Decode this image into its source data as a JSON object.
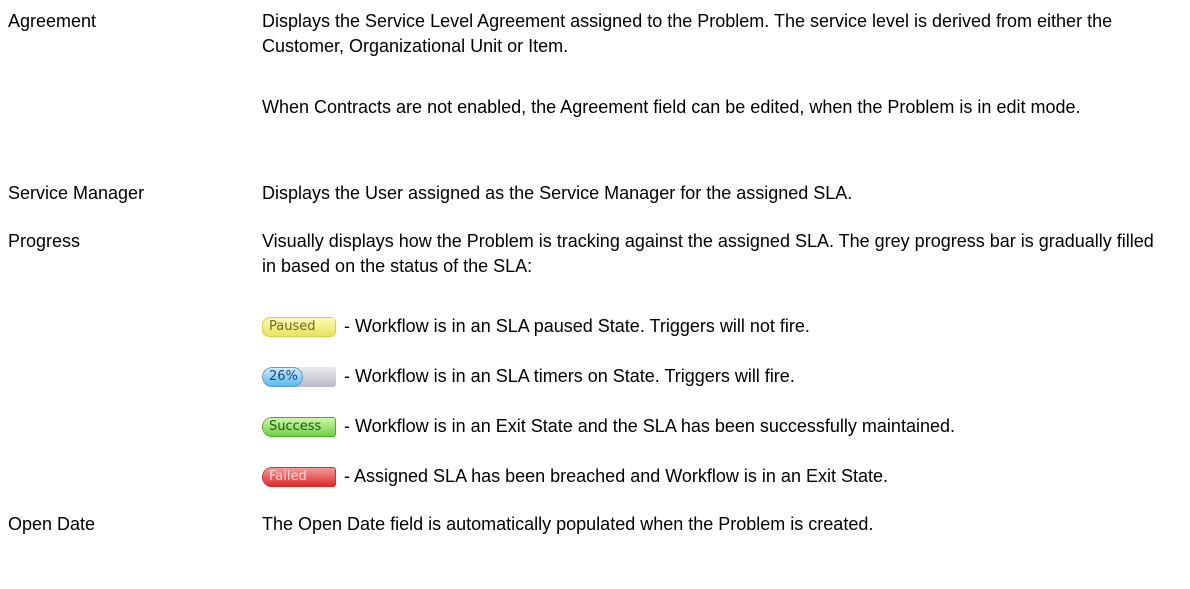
{
  "fields": [
    {
      "term": "Agreement",
      "paragraphs": [
        "Displays the Service Level Agreement assigned to the Problem. The service level is derived from either the Customer, Organizational Unit or Item.",
        "When Contracts are not enabled, the Agreement field can be edited, when the Problem is in edit mode."
      ]
    },
    {
      "term": "Service Manager",
      "paragraphs": [
        "Displays the User assigned as the Service Manager for the assigned SLA."
      ]
    },
    {
      "term": "Progress",
      "paragraphs": [
        "Visually displays how the Problem is tracking against the assigned SLA. The grey progress bar is gradually filled in based on the status of the SLA:"
      ],
      "statuses": [
        {
          "badge": "Paused",
          "text": "- Workflow is in an SLA paused State. Triggers will not fire.",
          "color": "#eeee6a"
        },
        {
          "badge": "26%",
          "progress": 0.26,
          "text": "- Workflow is in an SLA timers on State. Triggers will fire.",
          "color": "#57b9ea"
        },
        {
          "badge": "Success",
          "text": "- Workflow is in an Exit State and the SLA has been successfully maintained.",
          "color": "#71cf45"
        },
        {
          "badge": "Failed",
          "text": "- Assigned SLA has been breached and Workflow is in an Exit State.",
          "color": "#de2b2b"
        }
      ]
    },
    {
      "term": "Open Date",
      "paragraphs": [
        "The Open Date field is automatically populated when the Problem is created."
      ]
    }
  ]
}
